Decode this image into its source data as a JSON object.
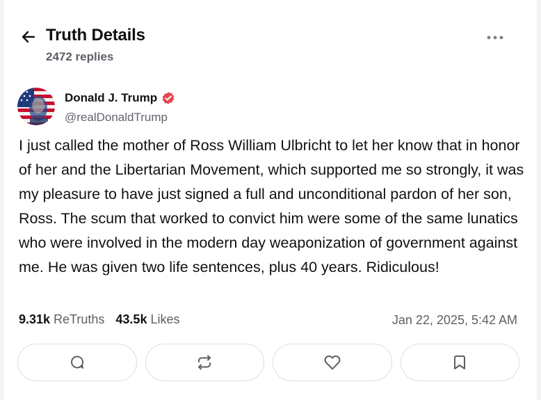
{
  "header": {
    "title": "Truth Details",
    "replies": "2472 replies"
  },
  "post": {
    "author_name": "Donald J. Trump",
    "handle": "@realDonaldTrump",
    "body": "I just called the mother of Ross William Ulbricht to let her know that in honor of her and the Libertarian Movement, which supported me so strongly, it was my pleasure to have just signed a full and unconditional pardon of her son, Ross. The scum that worked to convict him were some of the same lunatics who were involved in the modern day weaponization of government against me. He was given two life sentences, plus 40 years. Ridiculous!",
    "retruths_count": "9.31k",
    "retruths_label": "ReTruths",
    "likes_count": "43.5k",
    "likes_label": "Likes",
    "timestamp": "Jan 22, 2025, 5:42 AM"
  },
  "colors": {
    "verified_badge": "#e5484d",
    "muted_text": "#5c5f66",
    "border": "#dadde2"
  },
  "icons": {
    "back": "arrow-left-icon",
    "more": "more-horizontal-icon",
    "verified": "verified-badge-icon",
    "reply": "reply-icon",
    "retruth": "retruth-icon",
    "like": "heart-icon",
    "bookmark": "bookmark-icon"
  }
}
